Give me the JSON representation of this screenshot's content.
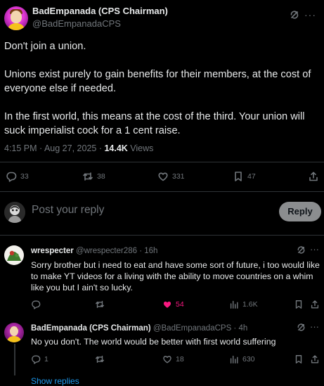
{
  "main_tweet": {
    "author_name": "BadEmpanada (CPS Chairman)",
    "author_handle": "@BadEmpanadaCPS",
    "paragraphs": [
      "Don't join a union.",
      "Unions exist purely to gain benefits for their members, at the cost of everyone else if needed.",
      "In the first world, this means at the cost of the third. Your union will suck imperialist cock for a 1 cent raise."
    ],
    "time": "4:15 PM · Aug 27, 2025 · ",
    "views_count": "14.4K",
    "views_label": " Views",
    "stats": {
      "replies": "33",
      "reposts": "38",
      "likes": "331",
      "bookmarks": "47"
    }
  },
  "composer": {
    "placeholder": "Post your reply",
    "reply_button": "Reply"
  },
  "replies": [
    {
      "name": "wrespecter",
      "handle": "@wrespecter286",
      "time": " · 16h",
      "text": "Sorry brother but i need to eat and have some sort of future, i too would like to make YT videos for a living with the ability to move countries on a whim like you but I ain't so lucky.",
      "stats": {
        "replies": "",
        "reposts": "",
        "likes": "54",
        "views": "1.6K"
      },
      "liked": true
    },
    {
      "name": "BadEmpanada (CPS Chairman)",
      "handle": "@BadEmpanadaCPS",
      "time": " · 4h",
      "text": "No you don't. The world would be better with first world suffering",
      "stats": {
        "replies": "1",
        "reposts": "",
        "likes": "18",
        "views": "630"
      },
      "liked": false
    }
  ],
  "show_replies": "Show replies",
  "colors": {
    "background": "#000000",
    "text": "#e7e9ea",
    "muted": "#71767b",
    "like": "#f91880",
    "link": "#1d9bf0"
  }
}
